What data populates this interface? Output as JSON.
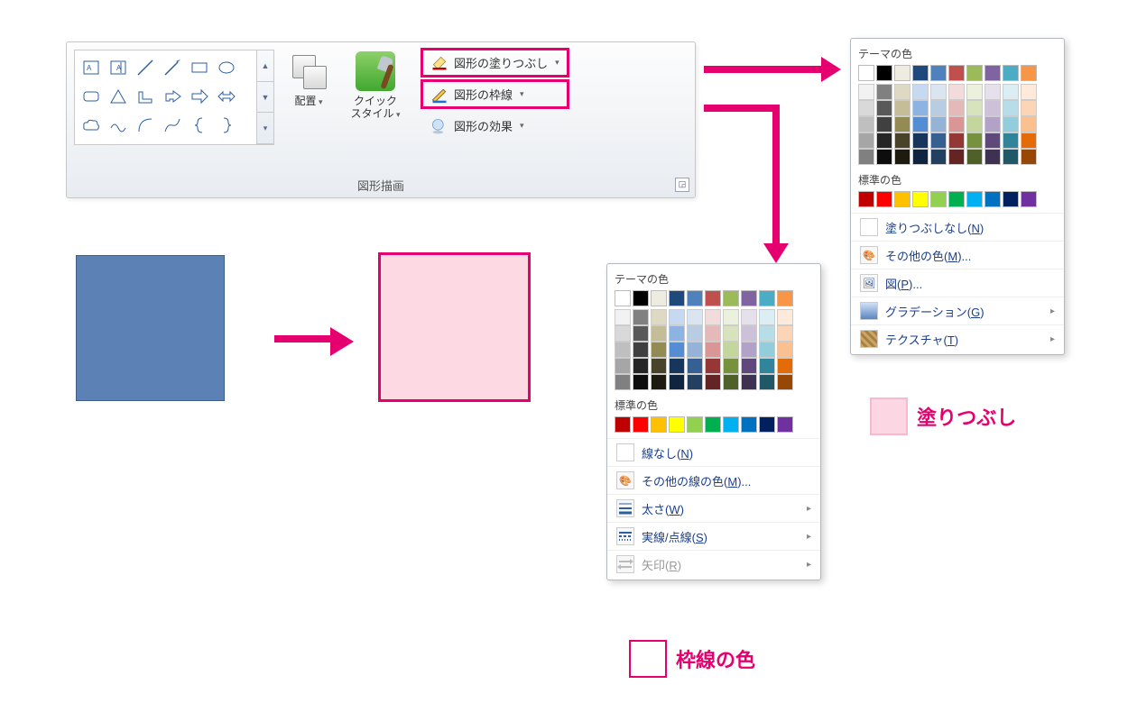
{
  "ribbon": {
    "group_label": "図形描画",
    "arrange_label": "配置",
    "quickstyle_label": "クイック\nスタイル",
    "shape_fill": "図形の塗りつぶし",
    "shape_outline": "図形の枠線",
    "shape_effects": "図形の効果"
  },
  "shapes_gallery": [
    "text-box",
    "vertical-text-box",
    "line",
    "line-arrow",
    "rectangle",
    "oval",
    "rounded-rect",
    "triangle",
    "right-angle",
    "bent-arrow",
    "right-arrow",
    "double-arrow",
    "cloud",
    "wave",
    "arc",
    "curve",
    "left-brace",
    "right-brace"
  ],
  "theme_colors": [
    "#ffffff",
    "#000000",
    "#eeece1",
    "#1f497d",
    "#4f81bd",
    "#c0504d",
    "#9bbb59",
    "#8064a2",
    "#4bacc6",
    "#f79646"
  ],
  "theme_tints": [
    [
      "#f2f2f2",
      "#d9d9d9",
      "#bfbfbf",
      "#a6a6a6",
      "#808080"
    ],
    [
      "#808080",
      "#595959",
      "#404040",
      "#262626",
      "#0d0d0d"
    ],
    [
      "#ddd9c3",
      "#c4bd97",
      "#948a54",
      "#494429",
      "#1d1b10"
    ],
    [
      "#c6d9f0",
      "#8db3e2",
      "#548dd4",
      "#17365d",
      "#0f243e"
    ],
    [
      "#dbe5f1",
      "#b8cce4",
      "#95b3d7",
      "#366092",
      "#244061"
    ],
    [
      "#f2dcdb",
      "#e5b9b7",
      "#d99694",
      "#953734",
      "#632423"
    ],
    [
      "#ebf1dd",
      "#d7e3bc",
      "#c3d69b",
      "#76923c",
      "#4f6128"
    ],
    [
      "#e5e0ec",
      "#ccc1d9",
      "#b2a2c7",
      "#5f497a",
      "#3f3151"
    ],
    [
      "#dbeef3",
      "#b7dde8",
      "#92cddc",
      "#31859b",
      "#205867"
    ],
    [
      "#fdeada",
      "#fbd5b5",
      "#fac08f",
      "#e36c09",
      "#974806"
    ]
  ],
  "standard_colors": [
    "#c00000",
    "#ff0000",
    "#ffc000",
    "#ffff00",
    "#92d050",
    "#00b050",
    "#00b0f0",
    "#0070c0",
    "#002060",
    "#7030a0"
  ],
  "popup_labels": {
    "theme": "テーマの色",
    "standard": "標準の色"
  },
  "fill_popup": {
    "no_fill": "塗りつぶしなし(N)",
    "more_colors": "その他の色(M)...",
    "picture": "図(P)...",
    "gradient": "グラデーション(G)",
    "texture": "テクスチャ(T)"
  },
  "outline_popup": {
    "no_line": "線なし(N)",
    "more_colors": "その他の線の色(M)...",
    "weight": "太さ(W)",
    "dashes": "実線/点線(S)",
    "arrows": "矢印(R)"
  },
  "legend": {
    "fill": "塗りつぶし",
    "outline": "枠線の色"
  },
  "colors": {
    "accent": "#e6006f"
  }
}
